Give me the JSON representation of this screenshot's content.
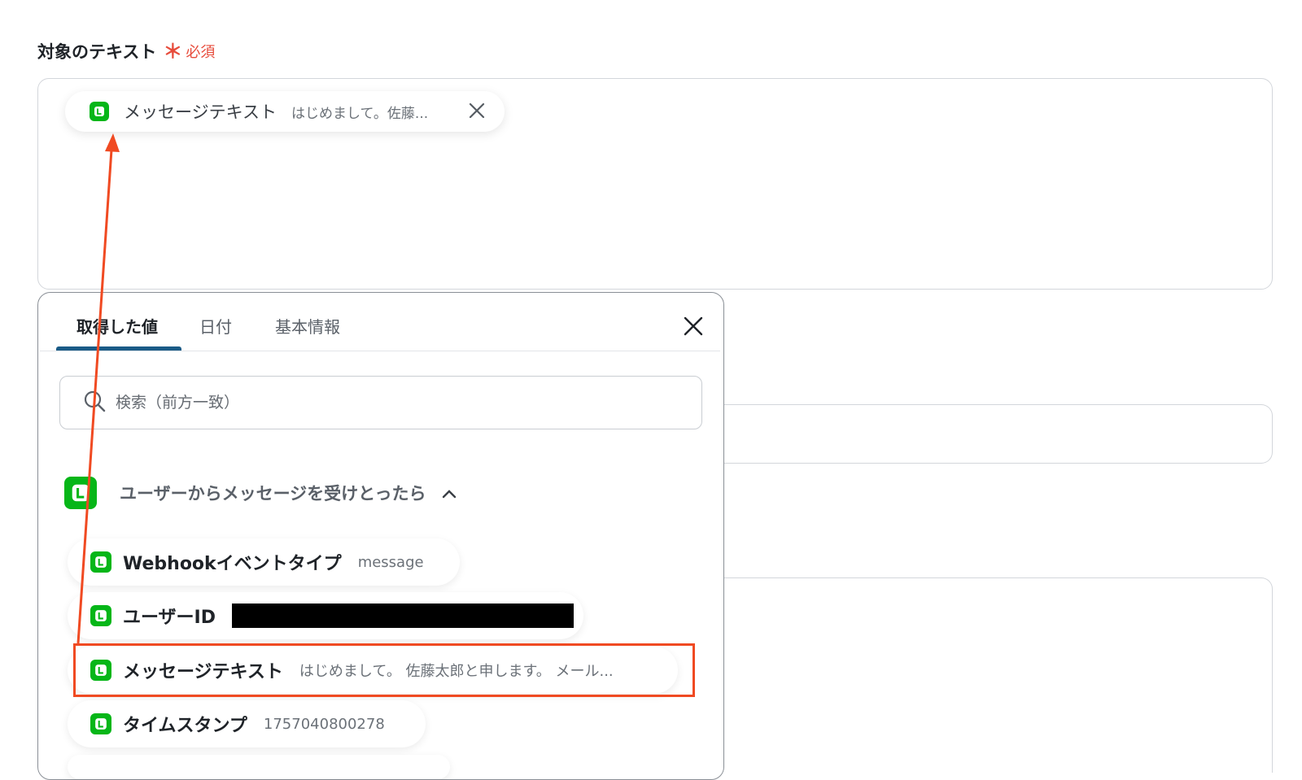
{
  "field": {
    "label": "対象のテキスト",
    "required_mark": "＊",
    "required_text": "必須"
  },
  "token_chip": {
    "label": "メッセージテキスト",
    "value": "はじめまして。佐藤...",
    "icon": "line-icon",
    "close_icon": "close-icon"
  },
  "popup": {
    "tabs": [
      {
        "label": "取得した値",
        "active": true
      },
      {
        "label": "日付",
        "active": false
      },
      {
        "label": "基本情報",
        "active": false
      }
    ],
    "search": {
      "placeholder": "検索（前方一致）"
    },
    "section": {
      "title": "ユーザーからメッセージを受けとったら"
    },
    "items": [
      {
        "label": "Webhookイベントタイプ",
        "value": "message"
      },
      {
        "label": "ユーザーID",
        "value": ""
      },
      {
        "label": "メッセージテキスト",
        "value": "はじめまして。 佐藤太郎と申します。 メール..."
      },
      {
        "label": "タイムスタンプ",
        "value": "1757040800278"
      }
    ]
  },
  "colors": {
    "line_green": "#06b618",
    "accent_blue": "#1a5b86",
    "annotation_red": "#f04a22",
    "required_red": "#e74c3c"
  }
}
